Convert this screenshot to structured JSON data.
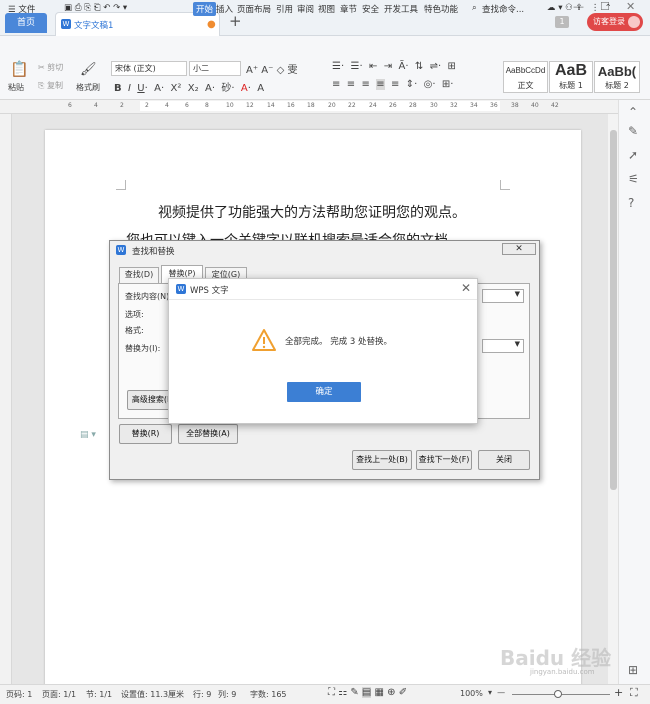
{
  "tabs": {
    "home": "首页",
    "doc": "文字文稿1",
    "new": "+"
  },
  "titlebar": {
    "page_count": "1",
    "visitor": "访客登录"
  },
  "menu": {
    "file": "☰ 文件",
    "items": [
      "开始",
      "插入",
      "页面布局",
      "引用",
      "审阅",
      "视图",
      "章节",
      "安全",
      "开发工具",
      "特色功能"
    ],
    "search": "查找命令..."
  },
  "ribbon": {
    "paste": "粘贴",
    "cut": "剪切",
    "copy": "复制",
    "format_painter": "格式刷",
    "font_name": "宋体 (正文)",
    "font_size": "小二",
    "styles": [
      {
        "preview": "AaBbCcDd",
        "name": "正文"
      },
      {
        "preview": "AaB",
        "name": "标题 1"
      },
      {
        "preview": "AaBb(",
        "name": "标题 2"
      }
    ]
  },
  "ruler": {
    "numbers": [
      "6",
      "4",
      "2",
      "2",
      "4",
      "6",
      "8",
      "10",
      "12",
      "14",
      "16",
      "18",
      "20",
      "22",
      "24",
      "26",
      "28",
      "30",
      "32",
      "34",
      "36",
      "38",
      "40",
      "42"
    ]
  },
  "document": {
    "line1": "视频提供了功能强大的方法帮助您证明您的观点。",
    "line2": "您也可以键入一个关键字以联机搜索最适合您的文档。"
  },
  "find_dialog": {
    "title": "查找和替换",
    "tabs": [
      "查找(D)",
      "替换(P)",
      "定位(G)"
    ],
    "find_label": "查找内容(N)",
    "options_label": "选项:",
    "format_label": "格式:",
    "replace_label": "替换为(I):",
    "advanced": "高级搜索(M)",
    "replace_btn": "替换(R)",
    "replace_all_btn": "全部替换(A)",
    "find_prev": "查找上一处(B)",
    "find_next": "查找下一处(F)",
    "close": "关闭"
  },
  "message_box": {
    "title": "WPS 文字",
    "message": "全部完成。 完成 3 处替换。",
    "ok": "确定"
  },
  "statusbar": {
    "page": "页码: 1",
    "pages": "页面: 1/1",
    "section": "节: 1/1",
    "position": "设置值: 11.3厘米",
    "row": "行: 9",
    "col": "列: 9",
    "words": "字数: 165",
    "zoom": "100%"
  },
  "watermark": {
    "text": "Baidu 经验",
    "sub": "jingyan.baidu.com"
  },
  "colors": {
    "accent": "#4a87d9",
    "visitor": "#e04848",
    "warning": "#f0a030"
  }
}
